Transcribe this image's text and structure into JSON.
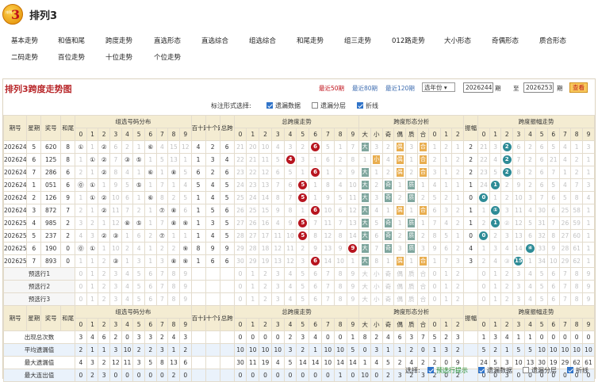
{
  "app": {
    "title": "排列3",
    "logo_small": "排列",
    "logo_num": "3"
  },
  "nav": {
    "row1": [
      "基本走势",
      "和值和尾",
      "跨度走势",
      "直选形态",
      "直选综合",
      "组选综合",
      "和尾走势",
      "组三走势",
      "012路走势",
      "大小形态",
      "奇偶形态",
      "质合形态"
    ],
    "row2": [
      "二码走势",
      "百位走势",
      "十位走势",
      "个位走势"
    ]
  },
  "panel": {
    "title": "排列3跨度走势图",
    "periods": [
      "最近50期",
      "最近80期",
      "最近120期"
    ],
    "select_value": "选年份",
    "from_value": "2026244",
    "from_unit": "期",
    "to_label": "至",
    "to_value": "2026253",
    "to_unit": "期",
    "query_label": "查看"
  },
  "options": {
    "label": "标注形式选择:",
    "items": [
      "遗漏数据",
      "遗漏分层",
      "折线"
    ]
  },
  "headers": {
    "period": "期号",
    "week": "星期",
    "prize": "奖号",
    "tail": "和尾",
    "group_dist": "组选号码分布",
    "bai_shi": "百十跨",
    "shi_ge": "十个跨",
    "span": "总跨",
    "span_trend": "总跨度走势",
    "span_shape": "跨度形态分析",
    "amplitude": "振幅",
    "amp_trend": "跨度振幅走势",
    "shape_cols": [
      "大",
      "小",
      "奇",
      "偶",
      "质",
      "合",
      "0",
      "1",
      "2"
    ],
    "digits": [
      "0",
      "1",
      "2",
      "3",
      "4",
      "5",
      "6",
      "7",
      "8",
      "9"
    ]
  },
  "rows": [
    {
      "period": "2026244",
      "week": "5",
      "prize": "620",
      "tail": "8",
      "bai_shi": "4",
      "shi_ge": "2",
      "span": "6",
      "amp": "2",
      "g": [
        "①",
        "1",
        "②",
        "6",
        "2",
        "1",
        "⑥",
        "4",
        "15",
        "12"
      ],
      "s": [
        "21",
        "20",
        "10",
        "4",
        "3",
        "2",
        "6",
        "5",
        "1",
        "7"
      ],
      "shape": [
        "大",
        "3",
        "2",
        "偶",
        "3",
        "合",
        "1",
        "2",
        "1"
      ],
      "a": [
        "21",
        "3",
        "2",
        "6",
        "2",
        "6",
        "5",
        "4",
        "1",
        "3"
      ]
    },
    {
      "period": "2026245",
      "week": "6",
      "prize": "125",
      "tail": "8",
      "bai_shi": "1",
      "shi_ge": "3",
      "span": "4",
      "amp": "2",
      "g": [
        "1",
        "①",
        "②",
        "7",
        "③",
        "⑤",
        "1",
        "5",
        "13",
        "1"
      ],
      "s": [
        "22",
        "21",
        "11",
        "5",
        "4",
        "3",
        "1",
        "6",
        "2",
        "8"
      ],
      "shape": [
        "1",
        "小",
        "4",
        "偶",
        "1",
        "合",
        "2",
        "1",
        "2"
      ],
      "a": [
        "22",
        "4",
        "2",
        "7",
        "2",
        "6",
        "21",
        "4",
        "2",
        "1"
      ]
    },
    {
      "period": "2026246",
      "week": "7",
      "prize": "286",
      "tail": "6",
      "bai_shi": "6",
      "shi_ge": "2",
      "span": "6",
      "amp": "2",
      "g": [
        "2",
        "1",
        "②",
        "8",
        "4",
        "1",
        "⑥",
        "1",
        "⑧",
        "5"
      ],
      "s": [
        "23",
        "22",
        "12",
        "6",
        "5",
        "1",
        "6",
        "1",
        "2",
        "9"
      ],
      "shape": [
        "大",
        "1",
        "2",
        "偶",
        "2",
        "合",
        "3",
        "1",
        "2"
      ],
      "a": [
        "23",
        "5",
        "2",
        "8",
        "2",
        "6",
        "7",
        "1",
        "2",
        "1"
      ]
    },
    {
      "period": "2026247",
      "week": "1",
      "prize": "051",
      "tail": "6",
      "bai_shi": "5",
      "shi_ge": "4",
      "span": "5",
      "amp": "1",
      "g": [
        "⓪",
        "①",
        "1",
        "9",
        "5",
        "⑤",
        "1",
        "7",
        "1",
        "4"
      ],
      "s": [
        "24",
        "23",
        "13",
        "7",
        "6",
        "5",
        "1",
        "8",
        "4",
        "10"
      ],
      "shape": [
        "大",
        "2",
        "奇",
        "1",
        "质",
        "1",
        "4",
        "1",
        "1"
      ],
      "a": [
        "24",
        "1",
        "2",
        "9",
        "2",
        "6",
        "5",
        "4",
        "7",
        "3"
      ]
    },
    {
      "period": "2026248",
      "week": "2",
      "prize": "126",
      "tail": "9",
      "bai_shi": "1",
      "shi_ge": "4",
      "span": "5",
      "amp": "0",
      "g": [
        "1",
        "①",
        "②",
        "10",
        "6",
        "1",
        "⑥",
        "8",
        "2",
        "5"
      ],
      "s": [
        "25",
        "24",
        "14",
        "8",
        "7",
        "5",
        "1",
        "9",
        "5",
        "11"
      ],
      "shape": [
        "大",
        "3",
        "奇",
        "2",
        "质",
        "2",
        "5",
        "2",
        "1"
      ],
      "a": [
        "0",
        "1",
        "2",
        "10",
        "3",
        "7",
        "6",
        "5",
        "8",
        "4"
      ]
    },
    {
      "period": "2026249",
      "week": "3",
      "prize": "872",
      "tail": "7",
      "bai_shi": "1",
      "shi_ge": "5",
      "span": "6",
      "amp": "1",
      "g": [
        "2",
        "1",
        "②",
        "11",
        "7",
        "2",
        "1",
        "⑦",
        "⑧",
        "6"
      ],
      "s": [
        "26",
        "25",
        "15",
        "9",
        "8",
        "1",
        "6",
        "10",
        "6",
        "12"
      ],
      "shape": [
        "大",
        "4",
        "1",
        "偶",
        "1",
        "合",
        "6",
        "3",
        "2"
      ],
      "a": [
        "1",
        "①",
        "3",
        "11",
        "4",
        "30",
        "6",
        "25",
        "58",
        "1"
      ]
    },
    {
      "period": "2026250",
      "week": "4",
      "prize": "985",
      "tail": "2",
      "bai_shi": "1",
      "shi_ge": "3",
      "span": "5",
      "amp": "1",
      "g": [
        "3",
        "2",
        "1",
        "12",
        "⑧",
        "⑤",
        "1",
        "7",
        "⑧",
        "⑨"
      ],
      "s": [
        "27",
        "26",
        "16",
        "4",
        "9",
        "5",
        "7",
        "11",
        "7",
        "13"
      ],
      "shape": [
        "大",
        "5",
        "奇",
        "1",
        "质",
        "1",
        "7",
        "4",
        "2"
      ],
      "a": [
        "2",
        "1",
        "②",
        "12",
        "5",
        "31",
        "7",
        "26",
        "59",
        "1"
      ]
    },
    {
      "period": "2026251",
      "week": "5",
      "prize": "237",
      "tail": "2",
      "bai_shi": "1",
      "shi_ge": "4",
      "span": "5",
      "amp": "0",
      "g": [
        "4",
        "3",
        "②",
        "③",
        "1",
        "6",
        "2",
        "⑦",
        "1",
        "1"
      ],
      "s": [
        "28",
        "27",
        "17",
        "11",
        "10",
        "5",
        "8",
        "12",
        "8",
        "14"
      ],
      "shape": [
        "大",
        "6",
        "奇",
        "2",
        "质",
        "2",
        "8",
        "5",
        "1"
      ],
      "a": [
        "0",
        "2",
        "3",
        "13",
        "6",
        "32",
        "8",
        "27",
        "60",
        "1"
      ]
    },
    {
      "period": "2026252",
      "week": "6",
      "prize": "190",
      "tail": "0",
      "bai_shi": "8",
      "shi_ge": "9",
      "span": "9",
      "amp": "4",
      "g": [
        "⓪",
        "①",
        "1",
        "10",
        "2",
        "4",
        "1",
        "2",
        "2",
        "⑨"
      ],
      "s": [
        "29",
        "28",
        "18",
        "12",
        "11",
        "2",
        "9",
        "13",
        "9",
        "9"
      ],
      "shape": [
        "大",
        "7",
        "奇",
        "3",
        "质",
        "3",
        "9",
        "6",
        "2"
      ],
      "a": [
        "1",
        "3",
        "4",
        "14",
        "④",
        "33",
        "9",
        "28",
        "61",
        "1"
      ]
    },
    {
      "period": "2026253",
      "week": "7",
      "prize": "893",
      "tail": "0",
      "bai_shi": "1",
      "shi_ge": "6",
      "span": "6",
      "amp": "3",
      "g": [
        "1",
        "1",
        "2",
        "③",
        "1",
        "3",
        "1",
        "3",
        "⑧",
        "⑨"
      ],
      "s": [
        "30",
        "29",
        "19",
        "13",
        "12",
        "3",
        "6",
        "14",
        "10",
        "1"
      ],
      "shape": [
        "大",
        "8",
        "1",
        "偶",
        "1",
        "合",
        "1",
        "7",
        "3"
      ],
      "a": [
        "2",
        "4",
        "③",
        "15",
        "1",
        "34",
        "10",
        "29",
        "62",
        "1"
      ]
    }
  ],
  "preview": [
    "预选行1",
    "预选行2",
    "预选行3"
  ],
  "stats": [
    {
      "label": "出现总次数",
      "g": [
        "3",
        "4",
        "6",
        "2",
        "0",
        "3",
        "3",
        "2",
        "4",
        "3"
      ],
      "s": [
        "0",
        "0",
        "0",
        "0",
        "2",
        "3",
        "4",
        "0",
        "0",
        "1"
      ],
      "shape": [
        "8",
        "2",
        "4",
        "6",
        "3",
        "7",
        "5",
        "2",
        "3"
      ],
      "a": [
        "1",
        "3",
        "4",
        "1",
        "1",
        "0",
        "0",
        "0",
        "0",
        "0"
      ]
    },
    {
      "label": "平均遗漏值",
      "g": [
        "2",
        "1",
        "1",
        "3",
        "10",
        "2",
        "2",
        "3",
        "1",
        "2"
      ],
      "s": [
        "10",
        "10",
        "10",
        "10",
        "3",
        "2",
        "1",
        "10",
        "10",
        "5"
      ],
      "shape": [
        "0",
        "3",
        "1",
        "1",
        "2",
        "0",
        "1",
        "3",
        "2"
      ],
      "a": [
        "5",
        "2",
        "1",
        "5",
        "5",
        "10",
        "10",
        "10",
        "10",
        "10"
      ]
    },
    {
      "label": "最大遗漏值",
      "g": [
        "4",
        "3",
        "2",
        "12",
        "11",
        "3",
        "5",
        "8",
        "13",
        "6"
      ],
      "s": [
        "30",
        "11",
        "19",
        "4",
        "5",
        "14",
        "14",
        "10",
        "14",
        "14"
      ],
      "shape": [
        "1",
        "4",
        "5",
        "2",
        "4",
        "2",
        "2",
        "0",
        "9"
      ],
      "a": [
        "24",
        "5",
        "3",
        "10",
        "13",
        "30",
        "19",
        "29",
        "62",
        "61"
      ]
    },
    {
      "label": "最大连出值",
      "g": [
        "0",
        "2",
        "3",
        "0",
        "0",
        "0",
        "0",
        "0",
        "2",
        "0"
      ],
      "s": [
        "0",
        "0",
        "0",
        "0",
        "0",
        "0",
        "0",
        "0",
        "1",
        "0"
      ],
      "shape": [
        "10",
        "0",
        "2",
        "3",
        "2",
        "3",
        "2",
        "0",
        "2"
      ],
      "a": [
        "0",
        "0",
        "3",
        "0",
        "0",
        "0",
        "0",
        "0",
        "0",
        "0"
      ]
    }
  ],
  "bottom": {
    "label": "选择:",
    "items": [
      "预选行提示",
      "遗漏数据",
      "遗漏分层",
      "折线"
    ]
  }
}
